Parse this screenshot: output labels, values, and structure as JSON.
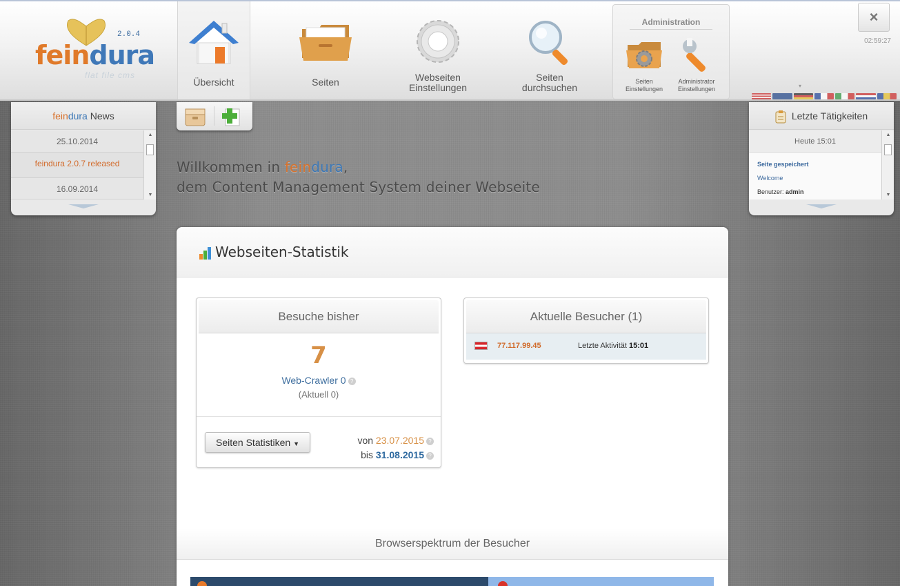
{
  "header": {
    "logo": {
      "version": "2.0.4",
      "name_orange": "fein",
      "name_blue": "dura",
      "tagline": "flat file cms"
    },
    "nav": [
      {
        "label": "Übersicht",
        "icon": "home-icon",
        "active": true
      },
      {
        "label": "Seiten",
        "icon": "folder-icon",
        "active": false
      },
      {
        "label": "Webseiten\nEinstellungen",
        "icon": "gear-icon",
        "active": false
      },
      {
        "label": "Seiten\ndurchsuchen",
        "icon": "magnifier-icon",
        "active": false
      }
    ],
    "admin": {
      "title": "Administration",
      "items": [
        {
          "label_1": "Seiten",
          "label_2": "Einstellungen",
          "icon": "folder-gear-icon"
        },
        {
          "label_1": "Administrator",
          "label_2": "Einstellungen",
          "icon": "wrench-icon"
        }
      ]
    },
    "close_label": "×",
    "clock": "02:59:27",
    "language_flags": [
      "us",
      "gb",
      "de",
      "fr",
      "it",
      "nl",
      "ro"
    ]
  },
  "news": {
    "title_orange": "fein",
    "title_blue": "dura",
    "title_rest": " News",
    "items": [
      {
        "date": "25.10.2014",
        "text": "feindura 2.0.7 released"
      },
      {
        "date": "16.09.2014"
      }
    ]
  },
  "activities": {
    "title": "Letzte Tätigkeiten",
    "date": "Heute 15:01",
    "action": "Seite gespeichert",
    "page": "Welcome",
    "user_label": "Benutzer:",
    "user": "admin"
  },
  "welcome": {
    "line1_a": "Willkommen in ",
    "line1_orange": "fein",
    "line1_blue": "dura",
    "line1_end": ",",
    "line2": "dem Content Management System deiner Webseite"
  },
  "stats": {
    "title": "Webseiten-Statistik",
    "visits": {
      "title": "Besuche bisher",
      "count": "7",
      "crawler": "Web-Crawler 0",
      "current": "(Aktuell 0)",
      "button": "Seiten Statistiken",
      "from_label": "von",
      "from_date": "23.07.2015",
      "to_label": "bis",
      "to_date": "31.08.2015"
    },
    "current_visitors": {
      "title": "Aktuelle Besucher (1)",
      "ip": "77.117.99.45",
      "activity_label": "Letzte Aktivität",
      "activity_time": "15:01"
    },
    "browser_title": "Browserspektrum der Besucher",
    "browser_shares": [
      {
        "browser": "firefox",
        "share": 0.57,
        "color": "#2c4a6b"
      },
      {
        "browser": "chrome",
        "share": 0.43,
        "color": "#8fb7e8"
      }
    ]
  }
}
